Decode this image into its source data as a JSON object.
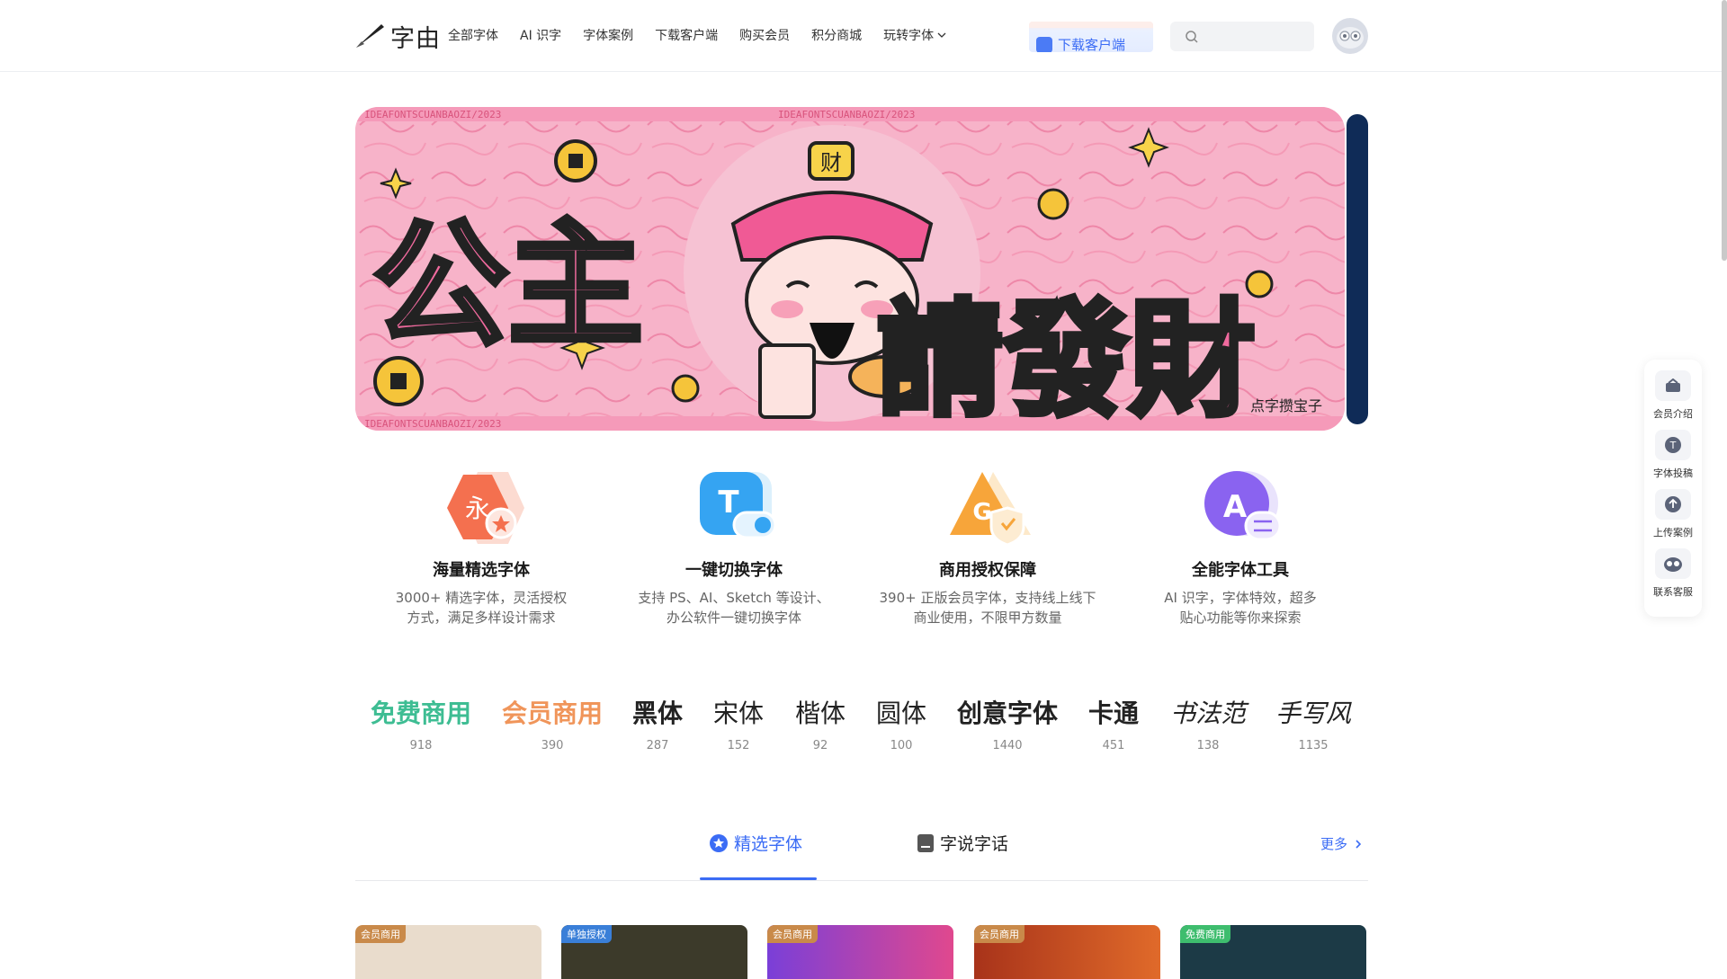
{
  "header": {
    "logo_text": "字由",
    "nav": [
      "全部字体",
      "AI 识字",
      "字体案例",
      "下载客户端",
      "购买会员",
      "积分商城",
      "玩转字体"
    ],
    "download_button": "下载客户端",
    "search_placeholder": ""
  },
  "banner": {
    "headline": [
      "公主",
      "請發財"
    ],
    "caption": "点字攒宝子",
    "border_text": "IDEAFONTSCUANBAOZI/2023",
    "dots": 4,
    "active_dot": 0
  },
  "features": [
    {
      "title": "海量精选字体",
      "desc": [
        "3000+ 精选字体，灵活授权",
        "方式，满足多样设计需求"
      ],
      "icon": "font-library-icon",
      "color": "#f4704f"
    },
    {
      "title": "一键切换字体",
      "desc": [
        "支持 PS、AI、Sketch 等设计、",
        "办公软件一键切换字体"
      ],
      "icon": "font-switch-icon",
      "color": "#3aa8f5"
    },
    {
      "title": "商用授权保障",
      "desc": [
        "390+ 正版会员字体，支持线上线下",
        "商业使用，不限甲方数量"
      ],
      "icon": "license-shield-icon",
      "color": "#f7a53a"
    },
    {
      "title": "全能字体工具",
      "desc": [
        "AI 识字，字体特效，超多",
        "贴心功能等你来探索"
      ],
      "icon": "font-tools-icon",
      "color": "#8a63f0"
    }
  ],
  "categories": [
    {
      "label": "免费商用",
      "count": "918",
      "color": "#3ebd93"
    },
    {
      "label": "会员商用",
      "count": "390",
      "color": "#f0955a"
    },
    {
      "label": "黑体",
      "count": "287",
      "color": "#222222"
    },
    {
      "label": "宋体",
      "count": "152",
      "color": "#222222"
    },
    {
      "label": "楷体",
      "count": "92",
      "color": "#222222"
    },
    {
      "label": "圆体",
      "count": "100",
      "color": "#222222"
    },
    {
      "label": "创意字体",
      "count": "1440",
      "color": "#222222"
    },
    {
      "label": "卡通",
      "count": "451",
      "color": "#222222"
    },
    {
      "label": "书法范",
      "count": "138",
      "color": "#222222"
    },
    {
      "label": "手写风",
      "count": "1135",
      "color": "#222222"
    }
  ],
  "tabs": [
    {
      "label": "精选字体",
      "icon": "star-badge-icon",
      "active": true
    },
    {
      "label": "字说字话",
      "icon": "document-icon",
      "active": false
    }
  ],
  "more": "更多",
  "cards": [
    {
      "badge": "会员商用",
      "badge_color": "#c98a4a",
      "bg": "#e9dccc"
    },
    {
      "badge": "单独授权",
      "badge_color": "#3a7fd8",
      "bg": "#3c3a2a"
    },
    {
      "badge": "会员商用",
      "badge_color": "#c98a4a",
      "bg": "#d84a8c"
    },
    {
      "badge": "会员商用",
      "badge_color": "#c98a4a",
      "bg": "#c5441e"
    },
    {
      "badge": "免费商用",
      "badge_color": "#3ebd6e",
      "bg": "#1c3a46"
    }
  ],
  "side": [
    "会员介绍",
    "字体投稿",
    "上传案例",
    "联系客服"
  ],
  "colors": {
    "accent": "#3b6cf5",
    "banner_pink": "#f5a8c2"
  }
}
